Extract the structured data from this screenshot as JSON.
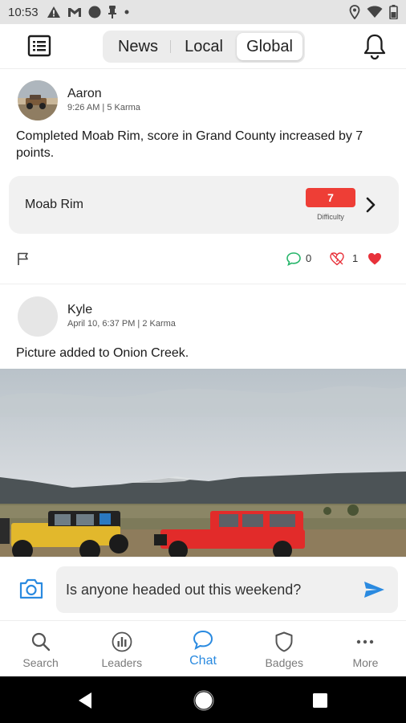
{
  "status_bar": {
    "time": "10:53",
    "icons_left": [
      "alert-icon",
      "gmail-icon",
      "record-icon",
      "pin-icon",
      "dot-icon"
    ],
    "icons_right": [
      "location-icon",
      "wifi-icon",
      "battery-icon"
    ]
  },
  "header": {
    "menu_icon": "list-icon",
    "tabs": [
      {
        "label": "News",
        "active": false
      },
      {
        "label": "Local",
        "active": false
      },
      {
        "label": "Global",
        "active": true
      }
    ],
    "notification_icon": "bell-icon"
  },
  "posts": [
    {
      "author": "Aaron",
      "meta": "9:26 AM | 5 Karma",
      "text": "Completed Moab Rim, score in Grand County increased by 7 points.",
      "trail": {
        "name": "Moab Rim",
        "difficulty_value": "7",
        "difficulty_label": "Difficulty"
      },
      "comment_count": "0",
      "like_count": "1"
    },
    {
      "author": "Kyle",
      "meta": "April 10, 6:37 PM | 2 Karma",
      "text": "Picture added to Onion Creek."
    }
  ],
  "composer": {
    "input_value": "Is anyone headed out this weekend?"
  },
  "tabbar": {
    "items": [
      {
        "label": "Search",
        "icon": "search-icon"
      },
      {
        "label": "Leaders",
        "icon": "leaders-icon"
      },
      {
        "label": "Chat",
        "icon": "chat-icon",
        "active": true
      },
      {
        "label": "Badges",
        "icon": "badge-icon"
      },
      {
        "label": "More",
        "icon": "more-icon"
      }
    ]
  },
  "colors": {
    "accent": "#2a8ae0",
    "difficulty": "#ee3e36",
    "like": "#e8313a",
    "comment": "#26b56a"
  }
}
